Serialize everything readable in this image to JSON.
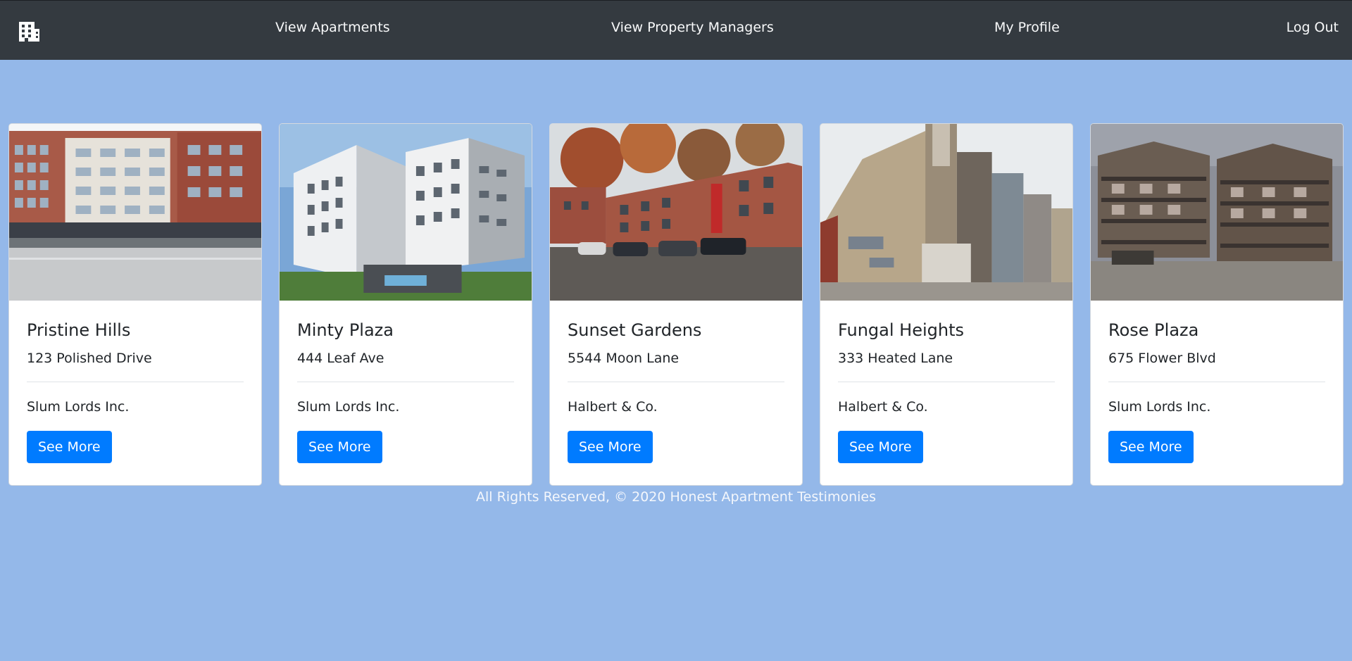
{
  "nav": {
    "logo_icon": "building-icon",
    "links": [
      "View Apartments",
      "View Property Managers",
      "My Profile",
      "Log Out"
    ]
  },
  "cards": [
    {
      "title": "Pristine Hills",
      "address": "123 Polished Drive",
      "manager": "Slum Lords Inc.",
      "button": "See More"
    },
    {
      "title": "Minty Plaza",
      "address": "444 Leaf Ave",
      "manager": "Slum Lords Inc.",
      "button": "See More"
    },
    {
      "title": "Sunset Gardens",
      "address": "5544 Moon Lane",
      "manager": "Halbert & Co.",
      "button": "See More"
    },
    {
      "title": "Fungal Heights",
      "address": "333 Heated Lane",
      "manager": "Halbert & Co.",
      "button": "See More"
    },
    {
      "title": "Rose Plaza",
      "address": "675 Flower Blvd",
      "manager": "Slum Lords Inc.",
      "button": "See More"
    }
  ],
  "footer": "All Rights Reserved, © 2020 Honest Apartment Testimonies",
  "colors": {
    "navbar": "#343a40",
    "page_bg": "#94b8e9",
    "button": "#007bff"
  }
}
